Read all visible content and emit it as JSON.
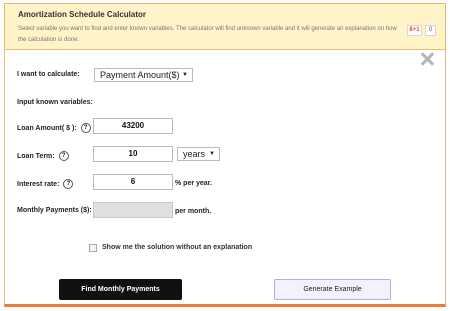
{
  "header": {
    "title": "Amortization Schedule Calculator",
    "description": "Select variable you want to find and enter known variables. The calculator will find unknown variable and it will generate an explanation on how the calculation is done.",
    "gplus_label": "8+1",
    "gplus_count": "0"
  },
  "calculate": {
    "label": "I want to calculate:",
    "selected": "Payment Amount($)"
  },
  "known_heading": "Input known variables:",
  "help_glyph": "?",
  "loan_amount": {
    "label": "Loan Amount( $ ):",
    "value": "43200"
  },
  "loan_term": {
    "label": "Loan Term:",
    "value": "10",
    "unit_selected": "years"
  },
  "interest_rate": {
    "label": "Interest rate:",
    "value": "6",
    "unit": "% per year."
  },
  "monthly_payments": {
    "label": "Monthly Payments ($):",
    "value": "",
    "unit": "per month."
  },
  "options": {
    "no_explanation_label": "Show me the solution without an explanation",
    "no_explanation_checked": false
  },
  "buttons": {
    "find": "Find Monthly Payments",
    "example": "Generate Example"
  },
  "icons": {
    "close": "close-icon",
    "dropdown": "chevron-down-icon",
    "help": "help-icon"
  },
  "colors": {
    "header_bg": "#fff4c8",
    "accent": "#f07a3a",
    "primary_button": "#111111"
  }
}
